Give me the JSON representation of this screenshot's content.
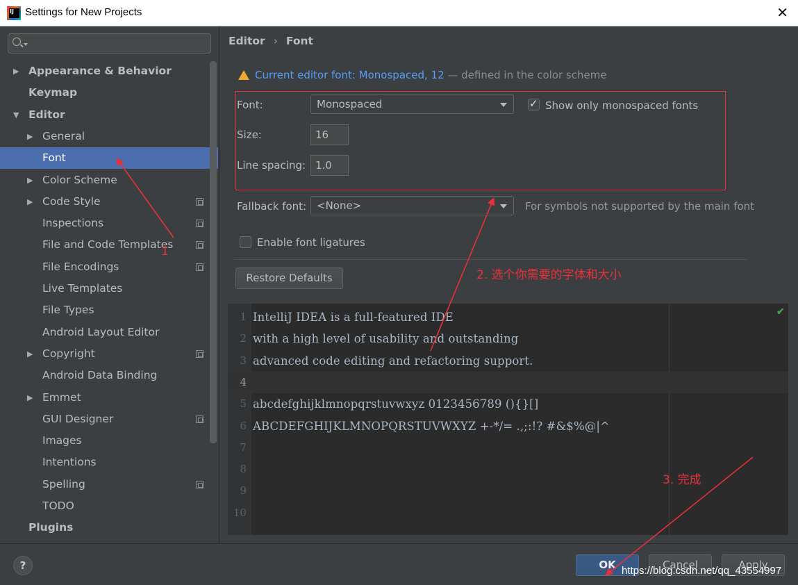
{
  "window": {
    "title": "Settings for New Projects",
    "close_label": "✕"
  },
  "sidebar": {
    "search_placeholder": "",
    "items": [
      {
        "label": "Appearance & Behavior",
        "bold": true,
        "arrow": "▶",
        "level": 0
      },
      {
        "label": "Keymap",
        "bold": true,
        "arrow": "",
        "level": 0
      },
      {
        "label": "Editor",
        "bold": true,
        "arrow": "▼",
        "level": 0
      },
      {
        "label": "General",
        "arrow": "▶",
        "level": 1
      },
      {
        "label": "Font",
        "arrow": "",
        "level": 1,
        "selected": true
      },
      {
        "label": "Color Scheme",
        "arrow": "▶",
        "level": 1
      },
      {
        "label": "Code Style",
        "arrow": "▶",
        "level": 1,
        "project": true
      },
      {
        "label": "Inspections",
        "arrow": "",
        "level": 1,
        "project": true
      },
      {
        "label": "File and Code Templates",
        "arrow": "",
        "level": 1,
        "project": true
      },
      {
        "label": "File Encodings",
        "arrow": "",
        "level": 1,
        "project": true
      },
      {
        "label": "Live Templates",
        "arrow": "",
        "level": 1
      },
      {
        "label": "File Types",
        "arrow": "",
        "level": 1
      },
      {
        "label": "Android Layout Editor",
        "arrow": "",
        "level": 1
      },
      {
        "label": "Copyright",
        "arrow": "▶",
        "level": 1,
        "project": true
      },
      {
        "label": "Android Data Binding",
        "arrow": "",
        "level": 1
      },
      {
        "label": "Emmet",
        "arrow": "▶",
        "level": 1
      },
      {
        "label": "GUI Designer",
        "arrow": "",
        "level": 1,
        "project": true
      },
      {
        "label": "Images",
        "arrow": "",
        "level": 1
      },
      {
        "label": "Intentions",
        "arrow": "",
        "level": 1
      },
      {
        "label": "Spelling",
        "arrow": "",
        "level": 1,
        "project": true
      },
      {
        "label": "TODO",
        "arrow": "",
        "level": 1
      },
      {
        "label": "Plugins",
        "bold": true,
        "arrow": "",
        "level": 0
      }
    ]
  },
  "breadcrumb": {
    "parent": "Editor",
    "separator": "›",
    "current": "Font"
  },
  "notice": {
    "link": "Current editor font: Monospaced, 12",
    "suffix": " — defined in the color scheme"
  },
  "font_settings": {
    "font_label": "Font:",
    "font_value": "Monospaced",
    "show_monospaced_label": "Show only monospaced fonts",
    "show_monospaced_checked": true,
    "size_label": "Size:",
    "size_value": "16",
    "line_spacing_label": "Line spacing:",
    "line_spacing_value": "1.0",
    "fallback_label": "Fallback font:",
    "fallback_value": "<None>",
    "fallback_hint": "For symbols not supported by the main font",
    "ligatures_label": "Enable font ligatures",
    "ligatures_checked": false,
    "restore_label": "Restore Defaults"
  },
  "preview": {
    "lines": [
      {
        "num": "1",
        "text": "IntelliJ IDEA is a full-featured IDE"
      },
      {
        "num": "2",
        "text": "with a high level of usability and outstanding"
      },
      {
        "num": "3",
        "text": "advanced code editing and refactoring support."
      },
      {
        "num": "4",
        "text": ""
      },
      {
        "num": "5",
        "text": "abcdefghijklmnopqrstuvwxyz 0123456789 (){}[]"
      },
      {
        "num": "6",
        "text": "ABCDEFGHIJKLMNOPQRSTUVWXYZ +-*/= .,;:!? #&$%@|^"
      },
      {
        "num": "7",
        "text": ""
      },
      {
        "num": "8",
        "text": ""
      },
      {
        "num": "9",
        "text": ""
      },
      {
        "num": "10",
        "text": ""
      }
    ],
    "current_line": 4
  },
  "footer": {
    "help_label": "?",
    "ok_label": "OK",
    "cancel_label": "Cancel",
    "apply_label": "Apply"
  },
  "annotations": {
    "step1": "1",
    "step2": "2. 选个你需要的字体和大小",
    "step3": "3. 完成",
    "color": "#e8303b"
  },
  "watermark": "https://blog.csdn.net/qq_43554997",
  "colors": {
    "selection": "#4b6eaf",
    "link": "#589df6",
    "background": "#3c3f41",
    "editor_bg": "#2b2b2b"
  }
}
